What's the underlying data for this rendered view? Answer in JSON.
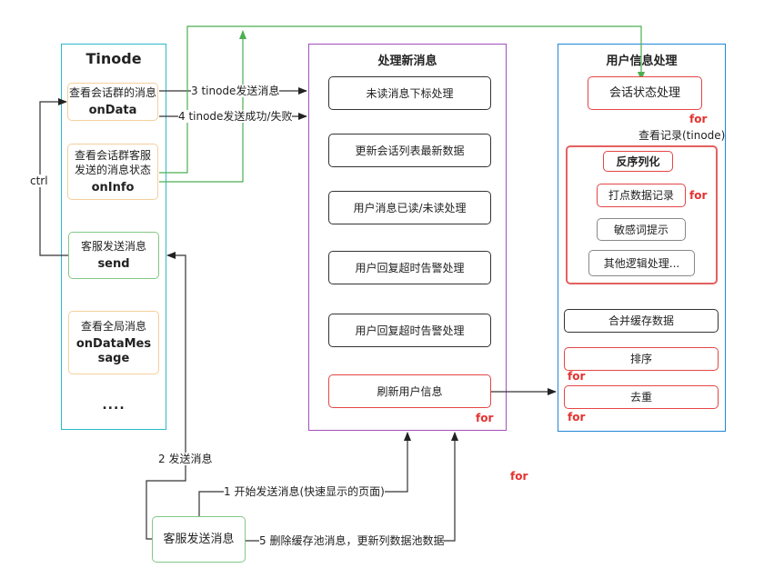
{
  "tinode": {
    "title": "Tinode",
    "nodes": [
      {
        "cn": "查看会话群的消息",
        "en": "onData"
      },
      {
        "cn": "查看会话群客服发送的消息状态",
        "en": "onInfo"
      },
      {
        "cn": "客服发送消息",
        "en": "send"
      },
      {
        "cn": "查看全局消息",
        "en": "onDataMessage"
      }
    ],
    "more": "...."
  },
  "process": {
    "title": "处理新消息",
    "nodes": [
      "未读消息下标处理",
      "更新会话列表最新数据",
      "用户消息已读/未读处理",
      "用户回复超时告警处理",
      "用户回复超时告警处理",
      "刷新用户信息"
    ],
    "for_label": "for"
  },
  "userinfo": {
    "title": "用户信息处理",
    "session_state": "会话状态处理",
    "for_label": "for",
    "record_label": "查看记录(tinode)",
    "group": {
      "deserialize": "反序列化",
      "tracking": "打点数据记录",
      "sensitive": "敏感词提示",
      "other": "其他逻辑处理..."
    },
    "merge_cache": "合并缓存数据",
    "sort": "排序",
    "dedupe": "去重"
  },
  "agent_send": "客服发送消息",
  "edges": {
    "ctrl": "ctrl",
    "step1": "1 开始发送消息(快速显示的页面)",
    "step2": "2 发送消息",
    "step3": "3 tinode发送消息",
    "step4": "4 tinode发送成功/失败",
    "step5": "5 删除缓存池消息，更新列数据池数据"
  },
  "stray_for": "for",
  "colors": {
    "tinode_border": "#2cb8cc",
    "process_border": "#a34fbd",
    "userinfo_border": "#1f86d6",
    "green_line": "#4caf50",
    "red": "#e5312f"
  }
}
